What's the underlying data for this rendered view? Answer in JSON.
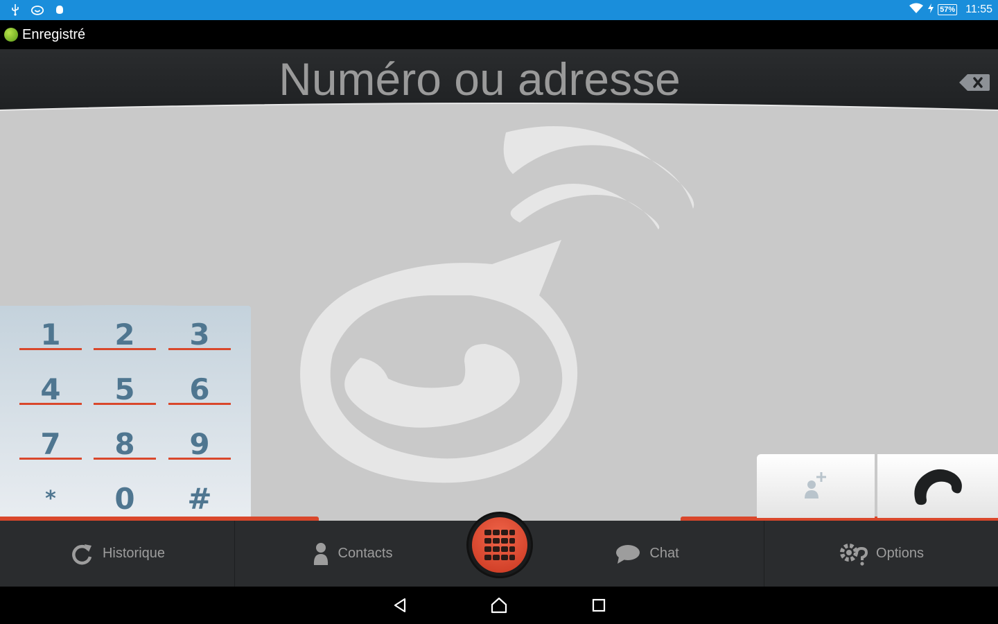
{
  "status_bar": {
    "battery": "57%",
    "time": "11:55"
  },
  "registration": {
    "status": "Enregistré",
    "indicator_color": "#7cc02a"
  },
  "address": {
    "placeholder": "Numéro ou adresse"
  },
  "dialpad": {
    "keys": [
      "1",
      "2",
      "3",
      "4",
      "5",
      "6",
      "7",
      "8",
      "9",
      "*",
      "0",
      "#"
    ],
    "accent": "#d9472b"
  },
  "tabs": {
    "history": "Historique",
    "contacts": "Contacts",
    "chat": "Chat",
    "options": "Options"
  },
  "icons": {
    "history": "refresh-icon",
    "contacts": "person-icon",
    "chat": "speech-bubble-icon",
    "options": "gears-question-icon",
    "dial": "keypad-icon",
    "add_contact": "add-contact-icon",
    "call": "phone-handset-icon",
    "backspace": "backspace-icon"
  }
}
